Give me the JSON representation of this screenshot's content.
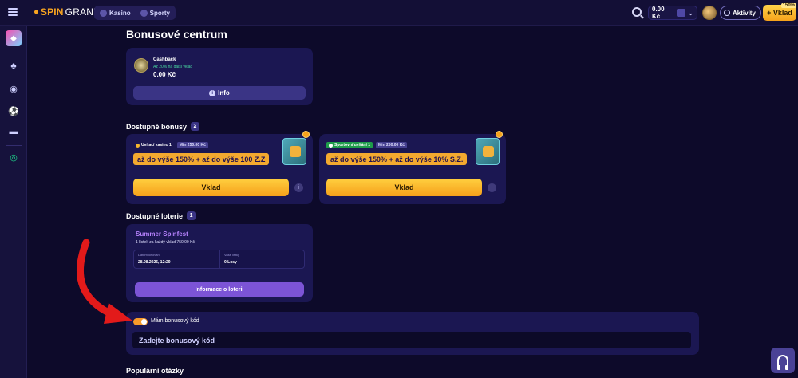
{
  "header": {
    "logo_spin": "SPIN",
    "logo_granny": "GRANNY",
    "nav": [
      "Kasino",
      "Sporty"
    ],
    "balance": "0.00 Kč",
    "activity_label": "Aktivity",
    "deposit_label": "Vklad",
    "deposit_badge": "150%"
  },
  "page": {
    "title": "Bonusové centrum",
    "cashback": {
      "title": "Cashback",
      "subtitle": "Až 20% na další vklad",
      "amount": "0.00 Kč",
      "info_label": "Info"
    },
    "bonuses_section": {
      "label": "Dostupné bonusy",
      "count": "2"
    },
    "bonuses": [
      {
        "tag": "Uvítací kasino 1",
        "min": "Min 250.00 Kč",
        "offer": "až do výše 150% + až do výše 100 Z.Z",
        "button": "Vklad",
        "tag_color": "#f6b72d"
      },
      {
        "tag": "Sportovní uvítání 1",
        "min": "Min 250.00 Kč",
        "offer": "až do výše 150% + až do výše 10% S.Z.",
        "button": "Vklad",
        "tag_color": "#1e9c4a"
      }
    ],
    "lotteries_section": {
      "label": "Dostupné loterie",
      "count": "1"
    },
    "lottery": {
      "title": "Summer Spinfest",
      "subtitle": "1 lístek za každý vklad 750.00 Kč",
      "date_label": "Datum losování",
      "date_value": "28.08.2025, 12:29",
      "tickets_label": "Vaše lístky",
      "tickets_value": "0 Losy",
      "button": "Informace o loterii"
    },
    "bonus_code": {
      "toggle_label": "Mám bonusový kód",
      "placeholder": "Zadejte bonusový kód"
    },
    "faq_title": "Populární otázky"
  },
  "colors": {
    "accent_orange": "#f5a01b",
    "purple": "#7c54d6",
    "card_bg": "#1b1752",
    "page_bg": "#0d0a2a"
  }
}
